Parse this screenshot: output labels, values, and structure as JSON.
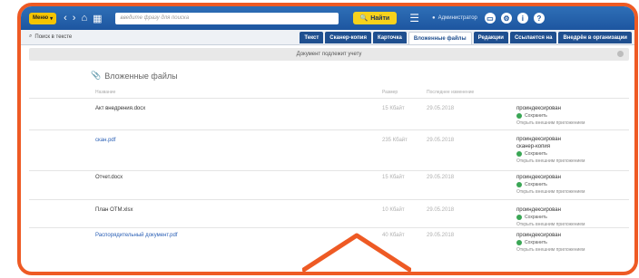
{
  "toolbar": {
    "menu_label": "Меню",
    "search_placeholder": "введите фразу для поиска",
    "find_label": "Найти",
    "user_label": "Администратор"
  },
  "tabs_row": {
    "search_in_text": "Поиск в тексте",
    "tabs": [
      {
        "label": "Текст",
        "active": false
      },
      {
        "label": "Сканер-копия",
        "active": false
      },
      {
        "label": "Карточка",
        "active": false
      },
      {
        "label": "Вложенные файлы",
        "active": true
      },
      {
        "label": "Редакции",
        "active": false
      },
      {
        "label": "Ссылается на",
        "active": false
      },
      {
        "label": "Внедрён в организации",
        "active": false
      }
    ]
  },
  "notice": "Документ подлежит учету",
  "section_title": "Вложенные файлы",
  "columns": {
    "name": "Название",
    "size": "Размер",
    "modified": "Последнее изменение"
  },
  "files": [
    {
      "name": "Акт внедрения.docx",
      "link": false,
      "size": "15 Кбайт",
      "date": "29.05.2018",
      "status": [
        "проиндексирован"
      ],
      "save": "Сохранить",
      "open": "Открыть внешним приложением"
    },
    {
      "name": "скан.pdf",
      "link": true,
      "size": "235 Кбайт",
      "date": "29.05.2018",
      "status": [
        "проиндексирован",
        "сканер-копия"
      ],
      "save": "Сохранить",
      "open": "Открыть внешним приложением"
    },
    {
      "name": "Отчет.docx",
      "link": false,
      "size": "15 Кбайт",
      "date": "29.05.2018",
      "status": [
        "проиндексирован"
      ],
      "save": "Сохранить",
      "open": "Открыть внешним приложением"
    },
    {
      "name": "План ОТМ.xlsx",
      "link": false,
      "size": "10 Кбайт",
      "date": "29.05.2018",
      "status": [
        "проиндексирован"
      ],
      "save": "Сохранить",
      "open": "Открыть внешним приложением"
    },
    {
      "name": "Распорядительный документ.pdf",
      "link": true,
      "size": "40 Кбайт",
      "date": "29.05.2018",
      "status": [
        "проиндексирован"
      ],
      "save": "Сохранить",
      "open": "Открыть внешним приложением"
    }
  ],
  "colors": {
    "highlight": "#ee5a24",
    "toolbar": "#1d56a0",
    "accent_yellow": "#f5c400",
    "link": "#2a5fb5"
  }
}
